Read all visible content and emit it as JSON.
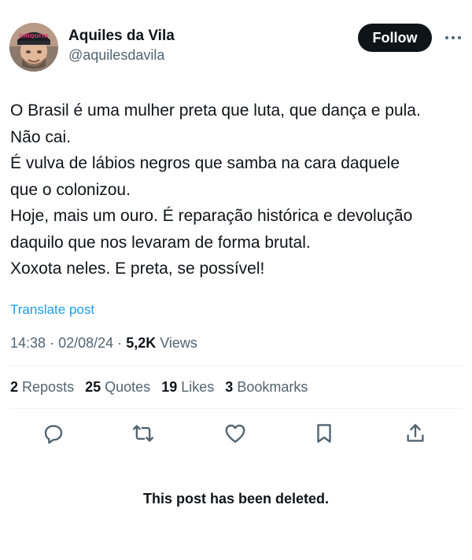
{
  "author": {
    "display_name": "Aquiles da Vila",
    "handle": "@aquilesdavila",
    "follow_label": "Follow"
  },
  "post": {
    "lines": [
      "O Brasil é uma mulher preta que luta, que dança e pula.",
      "Não cai.",
      "É vulva de lábios negros que samba na cara daquele",
      "que o colonizou.",
      "Hoje, mais um ouro. É reparação histórica e devolução",
      "daquilo que nos levaram de forma brutal.",
      "Xoxota neles. E preta, se possível!"
    ],
    "translate_label": "Translate post",
    "time": "14:38",
    "date": "02/08/24",
    "separator": "·",
    "views_count": "5,2K",
    "views_label": "Views"
  },
  "stats": {
    "reposts": {
      "count": "2",
      "label": "Reposts"
    },
    "quotes": {
      "count": "25",
      "label": "Quotes"
    },
    "likes": {
      "count": "19",
      "label": "Likes"
    },
    "bookmarks": {
      "count": "3",
      "label": "Bookmarks"
    }
  },
  "actions": [
    "reply-icon",
    "repost-icon",
    "like-icon",
    "bookmark-icon",
    "share-icon"
  ],
  "deleted_notice": "This post has been deleted.",
  "colors": {
    "text": "#0f1419",
    "secondary": "#536471",
    "link": "#1d9bf0",
    "divider": "#eff3f4",
    "follow_bg": "#0f1419"
  }
}
